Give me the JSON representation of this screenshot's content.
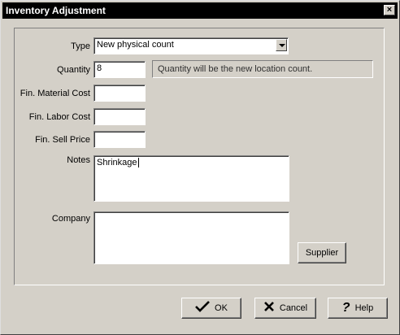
{
  "window": {
    "title": "Inventory Adjustment",
    "close_label": "×"
  },
  "form": {
    "type_label": "Type",
    "type_value": "New physical count",
    "quantity_label": "Quantity",
    "quantity_value": "8",
    "quantity_hint": "Quantity will be the new location count.",
    "material_cost_label": "Fin. Material Cost",
    "material_cost_value": "",
    "labor_cost_label": "Fin. Labor Cost",
    "labor_cost_value": "",
    "sell_price_label": "Fin. Sell Price",
    "sell_price_value": "",
    "notes_label": "Notes",
    "notes_value": "Shrinkage",
    "company_label": "Company",
    "company_value": "",
    "supplier_label": "Supplier"
  },
  "buttons": {
    "ok_label": "OK",
    "cancel_label": "Cancel",
    "help_label": "Help"
  },
  "icons": {
    "ok": "checkmark-icon",
    "cancel": "x-icon",
    "help": "question-icon"
  }
}
